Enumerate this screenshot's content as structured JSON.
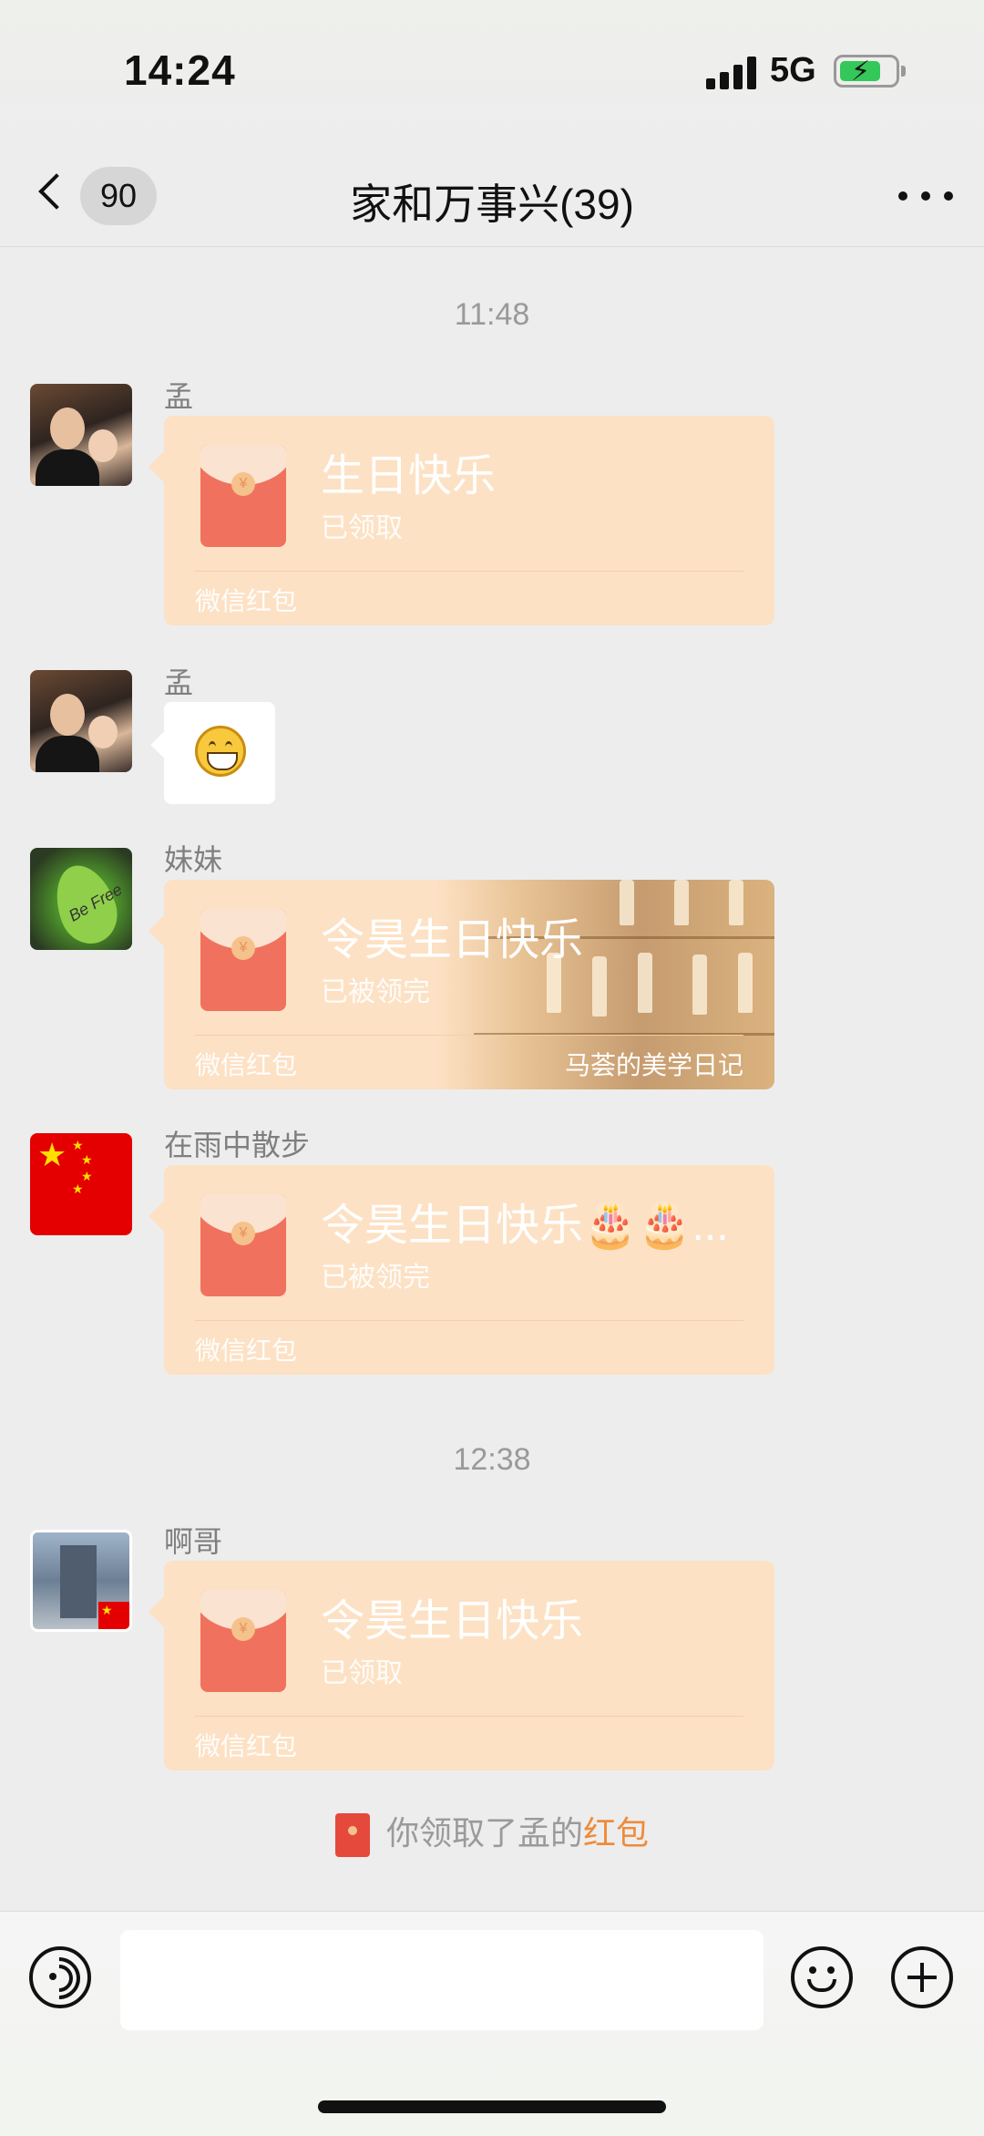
{
  "status_bar": {
    "time": "14:24",
    "network": "5G"
  },
  "nav": {
    "back_unread_count": "90",
    "title": "家和万事兴(39)"
  },
  "timestamps": [
    "11:48",
    "12:38"
  ],
  "messages": [
    {
      "sender": "孟",
      "type": "red_packet",
      "title": "生日快乐",
      "status": "已领取",
      "footer": "微信红包"
    },
    {
      "sender": "孟",
      "type": "emoji",
      "emoji": "grin-face"
    },
    {
      "sender": "妹妹",
      "type": "red_packet",
      "title": "令昊生日快乐",
      "status": "已被领完",
      "footer": "微信红包",
      "cover_label": "马荟的美学日记"
    },
    {
      "sender": "在雨中散步",
      "type": "red_packet",
      "title": "令昊生日快乐🎂🎂...",
      "status": "已被领完",
      "footer": "微信红包"
    },
    {
      "sender": "啊哥",
      "type": "red_packet",
      "title": "令昊生日快乐",
      "status": "已领取",
      "footer": "微信红包"
    }
  ],
  "system_messages": [
    {
      "prefix": "你领取了孟的",
      "link": "红包"
    }
  ],
  "input_bar": {
    "placeholder": ""
  },
  "colors": {
    "background": "#ededed",
    "red_packet": "#fde1c4",
    "link": "#ee8b3a"
  },
  "icons": [
    "back-chevron-icon",
    "more-dots-icon",
    "voice-icon",
    "emoji-icon",
    "plus-icon",
    "red-packet-icon"
  ]
}
